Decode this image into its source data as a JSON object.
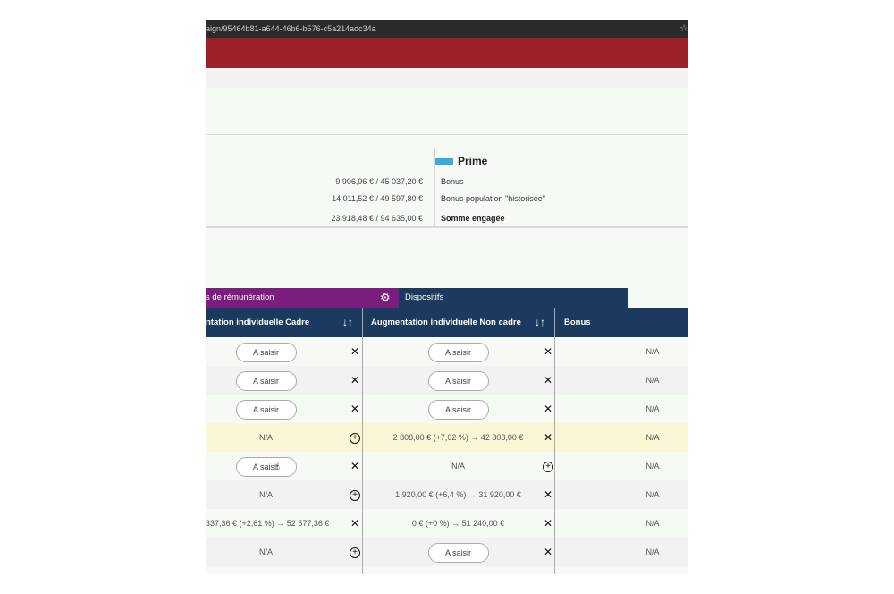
{
  "browser": {
    "url_fragment": "aign/95464b81-a644-46b6-b576-c5a214adc34a",
    "star_icon": "star-icon"
  },
  "summary": {
    "amounts": [
      "9 906,96 €  / 45 037,20 €",
      "14 011,52 €  / 49 597,80 €",
      "23 918,48 €  / 94 635,00 €"
    ],
    "prime_title": "Prime",
    "prime_color": "#3aaad8",
    "labels": [
      "Bonus",
      "Bonus population \"historisée\"",
      "Somme engagée"
    ]
  },
  "tabs": {
    "remuneration": "s de rémunération",
    "dispositifs": "Dispositifs",
    "colors": {
      "remuneration": "#7a1d7e",
      "dispositifs": "#1b3a5e"
    }
  },
  "table": {
    "headers": {
      "cadre": "ntation individuelle Cadre",
      "non_cadre": "Augmentation individuelle Non cadre",
      "bonus": "Bonus"
    },
    "rows": [
      {
        "cadre": "A saisir",
        "cadre_type": "button",
        "cadre_action": "x",
        "non_cadre": "A saisir",
        "non_cadre_type": "button",
        "non_cadre_action": "x",
        "bonus": "N/A",
        "style": "odd"
      },
      {
        "cadre": "A saisir",
        "cadre_type": "button",
        "cadre_action": "x",
        "non_cadre": "A saisir",
        "non_cadre_type": "button",
        "non_cadre_action": "x",
        "bonus": "N/A",
        "style": "even"
      },
      {
        "cadre": "A saisir",
        "cadre_type": "button",
        "cadre_action": "x",
        "non_cadre": "A saisir",
        "non_cadre_type": "button",
        "non_cadre_action": "x",
        "bonus": "N/A",
        "style": "odd"
      },
      {
        "cadre": "N/A",
        "cadre_type": "text",
        "cadre_action": "plus",
        "non_cadre": "2 808,00 € (+7,02 %) → 42 808,00 €",
        "non_cadre_type": "text",
        "non_cadre_action": "x",
        "bonus": "N/A",
        "style": "hl"
      },
      {
        "cadre": "A saisir",
        "cadre_type": "button",
        "cadre_action": "x",
        "non_cadre": "N/A",
        "non_cadre_type": "text",
        "non_cadre_action": "plus",
        "bonus": "N/A",
        "style": "odd"
      },
      {
        "cadre": "N/A",
        "cadre_type": "text",
        "cadre_action": "plus",
        "non_cadre": "1 920,00 € (+6,4 %) → 31 920,00 €",
        "non_cadre_type": "text",
        "non_cadre_action": "x",
        "bonus": "N/A",
        "style": "even"
      },
      {
        "cadre": "337,36 € (+2,61 %) → 52 577,36 €",
        "cadre_type": "text",
        "cadre_action": "x",
        "non_cadre": "0 € (+0 %) → 51 240,00 €",
        "non_cadre_type": "text",
        "non_cadre_action": "x",
        "bonus": "N/A",
        "style": "odd"
      },
      {
        "cadre": "N/A",
        "cadre_type": "text",
        "cadre_action": "plus",
        "non_cadre": "A saisir",
        "non_cadre_type": "button",
        "non_cadre_action": "x",
        "bonus": "N/A",
        "style": "even"
      }
    ]
  }
}
